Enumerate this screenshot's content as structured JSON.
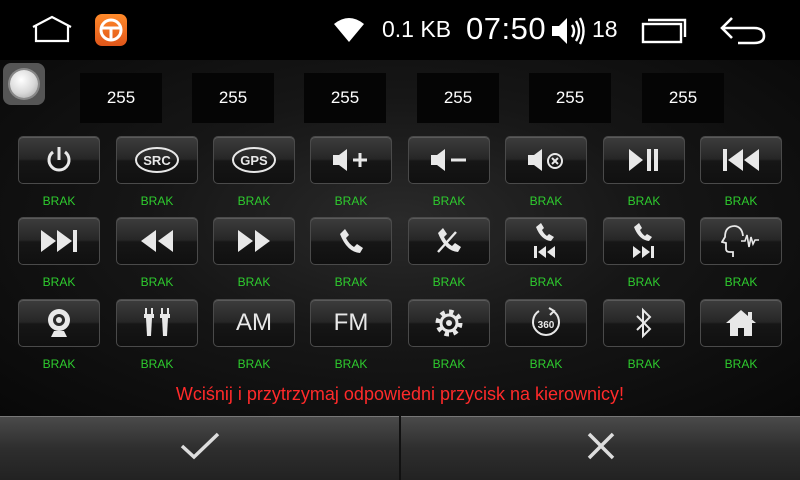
{
  "status": {
    "net_speed": "0.1 KB",
    "time": "07:50",
    "volume": "18"
  },
  "values": [
    "255",
    "255",
    "255",
    "255",
    "255",
    "255"
  ],
  "keys": [
    {
      "icon": "power-icon",
      "status": "BRAK"
    },
    {
      "icon": "src-icon",
      "label": "SRC",
      "status": "BRAK"
    },
    {
      "icon": "gps-icon",
      "label": "GPS",
      "status": "BRAK"
    },
    {
      "icon": "volume-up-icon",
      "status": "BRAK"
    },
    {
      "icon": "volume-down-icon",
      "status": "BRAK"
    },
    {
      "icon": "mute-icon",
      "status": "BRAK"
    },
    {
      "icon": "play-pause-icon",
      "status": "BRAK"
    },
    {
      "icon": "previous-track-icon",
      "status": "BRAK"
    },
    {
      "icon": "next-track-icon",
      "status": "BRAK"
    },
    {
      "icon": "rewind-icon",
      "status": "BRAK"
    },
    {
      "icon": "fast-forward-icon",
      "status": "BRAK"
    },
    {
      "icon": "phone-answer-icon",
      "status": "BRAK"
    },
    {
      "icon": "phone-hangup-icon",
      "status": "BRAK"
    },
    {
      "icon": "phone-previous-icon",
      "status": "BRAK"
    },
    {
      "icon": "phone-next-icon",
      "status": "BRAK"
    },
    {
      "icon": "voice-command-icon",
      "status": "BRAK"
    },
    {
      "icon": "camera-icon",
      "status": "BRAK"
    },
    {
      "icon": "aux-rca-icon",
      "status": "BRAK"
    },
    {
      "icon": "am-icon",
      "label": "AM",
      "status": "BRAK"
    },
    {
      "icon": "fm-icon",
      "label": "FM",
      "status": "BRAK"
    },
    {
      "icon": "settings-gear-icon",
      "status": "BRAK"
    },
    {
      "icon": "camera-360-icon",
      "label": "360",
      "status": "BRAK"
    },
    {
      "icon": "bluetooth-icon",
      "status": "BRAK"
    },
    {
      "icon": "home-icon",
      "status": "BRAK"
    }
  ],
  "instruction": "Wciśnij i przytrzymaj odpowiedni przycisk na kierownicy!",
  "colors": {
    "status_ok": "#2ecc2e",
    "instruction": "#ff2a2a"
  }
}
